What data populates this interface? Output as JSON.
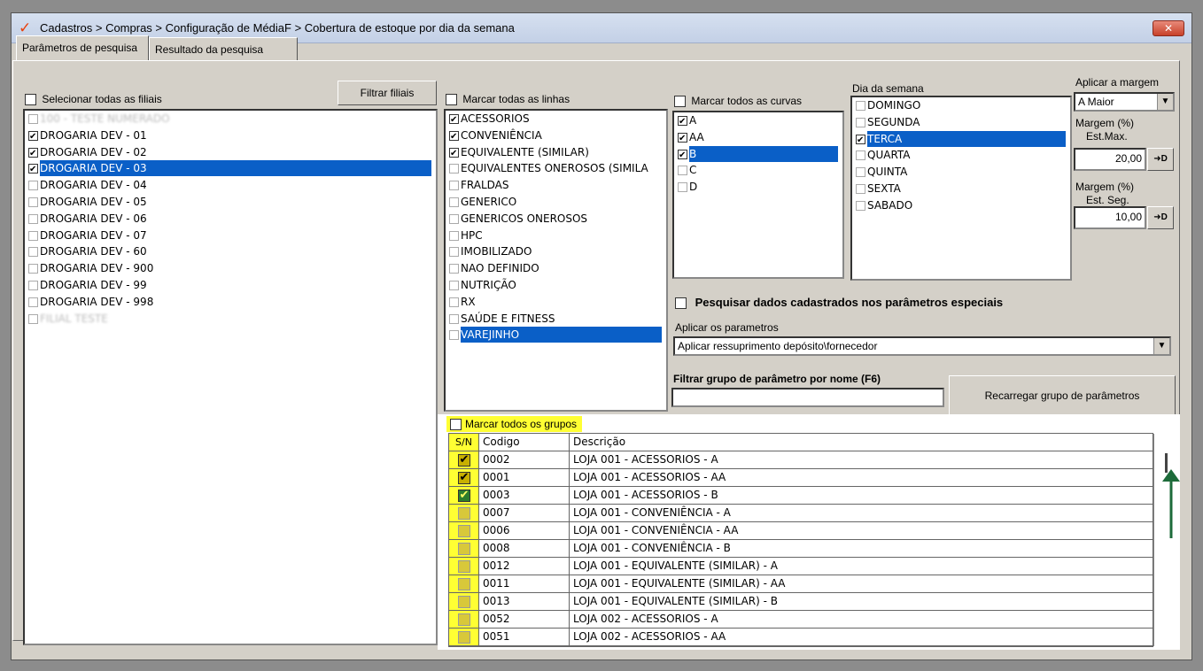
{
  "window": {
    "title": "Cadastros > Compras > Configuração de MédiaF > Cobertura de estoque por dia da semana",
    "close_label": "✕"
  },
  "tabs": [
    {
      "label": "Parâmetros de pesquisa"
    },
    {
      "label": "Resultado da pesquisa"
    }
  ],
  "filiais": {
    "select_all_label": "Selecionar todas as filiais",
    "filter_button": "Filtrar filiais",
    "items": [
      {
        "label": "100 - TESTE NUMERADO",
        "checked": false,
        "blurred": true
      },
      {
        "label": "DROGARIA DEV - 01",
        "checked": true
      },
      {
        "label": "DROGARIA DEV - 02",
        "checked": true
      },
      {
        "label": "DROGARIA DEV - 03",
        "checked": true,
        "selected": true
      },
      {
        "label": "DROGARIA DEV - 04",
        "checked": false
      },
      {
        "label": "DROGARIA DEV - 05",
        "checked": false
      },
      {
        "label": "DROGARIA DEV - 06",
        "checked": false
      },
      {
        "label": "DROGARIA DEV - 07",
        "checked": false
      },
      {
        "label": "DROGARIA DEV - 60",
        "checked": false
      },
      {
        "label": "DROGARIA DEV - 900",
        "checked": false
      },
      {
        "label": "DROGARIA DEV - 99",
        "checked": false
      },
      {
        "label": "DROGARIA DEV - 998",
        "checked": false
      },
      {
        "label": "FILIAL TESTE",
        "checked": false,
        "blurred": true
      }
    ]
  },
  "linhas": {
    "select_all_label": "Marcar todas as linhas",
    "items": [
      {
        "label": "ACESSORIOS",
        "checked": true
      },
      {
        "label": "CONVENIÊNCIA",
        "checked": true
      },
      {
        "label": "EQUIVALENTE (SIMILAR)",
        "checked": true
      },
      {
        "label": "EQUIVALENTES ONEROSOS (SIMILA",
        "checked": false
      },
      {
        "label": "FRALDAS",
        "checked": false
      },
      {
        "label": "GENERICO",
        "checked": false
      },
      {
        "label": "GENERICOS ONEROSOS",
        "checked": false
      },
      {
        "label": "HPC",
        "checked": false
      },
      {
        "label": "IMOBILIZADO",
        "checked": false
      },
      {
        "label": "NAO DEFINIDO",
        "checked": false
      },
      {
        "label": "NUTRIÇÃO",
        "checked": false
      },
      {
        "label": "RX",
        "checked": false
      },
      {
        "label": "SAÚDE E FITNESS",
        "checked": false
      },
      {
        "label": "VAREJINHO",
        "checked": false,
        "selected": true
      }
    ]
  },
  "curvas": {
    "select_all_label": "Marcar todos as curvas",
    "items": [
      {
        "label": "A",
        "checked": true
      },
      {
        "label": "AA",
        "checked": true
      },
      {
        "label": "B",
        "checked": true,
        "selected": true
      },
      {
        "label": "C",
        "checked": false
      },
      {
        "label": "D",
        "checked": false
      }
    ]
  },
  "dias": {
    "label": "Dia da semana",
    "items": [
      {
        "label": "DOMINGO",
        "checked": false
      },
      {
        "label": "SEGUNDA",
        "checked": false
      },
      {
        "label": "TERCA",
        "checked": true,
        "selected": true
      },
      {
        "label": "QUARTA",
        "checked": false
      },
      {
        "label": "QUINTA",
        "checked": false
      },
      {
        "label": "SEXTA",
        "checked": false
      },
      {
        "label": "SABADO",
        "checked": false
      }
    ]
  },
  "margem": {
    "aplicar_label": "Aplicar a margem",
    "aplicar_value": "A Maior",
    "max_label_1": "Margem (%)",
    "max_label_2": "Est.Max.",
    "max_value": "20,00",
    "seg_label_1": "Margem (%)",
    "seg_label_2": "Est. Seg.",
    "seg_value": "10,00",
    "apply_btn": "➜D"
  },
  "especiais": {
    "label": "Pesquisar dados cadastrados nos parâmetros especiais",
    "aplicar_parametros_label": "Aplicar os parametros",
    "aplicar_parametros_value": "Aplicar ressuprimento depósito\\fornecedor",
    "filtrar_label": "Filtrar grupo de parâmetro por nome (F6)",
    "filtrar_value": "",
    "recarregar_btn": "Recarregar grupo de parâmetros"
  },
  "grupos": {
    "select_all_label": "Marcar todos os grupos",
    "columns": [
      "S/N",
      "Codigo",
      "Descrição"
    ],
    "rows": [
      {
        "checked": true,
        "codigo": "0002",
        "descricao": "LOJA 001 - ACESSORIOS - A"
      },
      {
        "checked": true,
        "codigo": "0001",
        "descricao": "LOJA 001 - ACESSORIOS - AA"
      },
      {
        "checked": true,
        "dark": true,
        "codigo": "0003",
        "descricao": "LOJA 001 - ACESSORIOS - B"
      },
      {
        "checked": false,
        "codigo": "0007",
        "descricao": "LOJA 001 - CONVENIÊNCIA - A"
      },
      {
        "checked": false,
        "codigo": "0006",
        "descricao": "LOJA 001 - CONVENIÊNCIA - AA"
      },
      {
        "checked": false,
        "codigo": "0008",
        "descricao": "LOJA 001 - CONVENIÊNCIA - B"
      },
      {
        "checked": false,
        "codigo": "0012",
        "descricao": "LOJA 001 - EQUIVALENTE (SIMILAR) - A"
      },
      {
        "checked": false,
        "codigo": "0011",
        "descricao": "LOJA 001 - EQUIVALENTE (SIMILAR) - AA"
      },
      {
        "checked": false,
        "codigo": "0013",
        "descricao": "LOJA 001 - EQUIVALENTE (SIMILAR) - B"
      },
      {
        "checked": false,
        "codigo": "0052",
        "descricao": "LOJA 002 - ACESSORIOS - A"
      },
      {
        "checked": false,
        "codigo": "0051",
        "descricao": "LOJA 002 - ACESSORIOS - AA"
      }
    ]
  },
  "colors": {
    "highlight": "#ffff33",
    "selection": "#0a5fc7",
    "arrow": "#1d6b3a"
  }
}
